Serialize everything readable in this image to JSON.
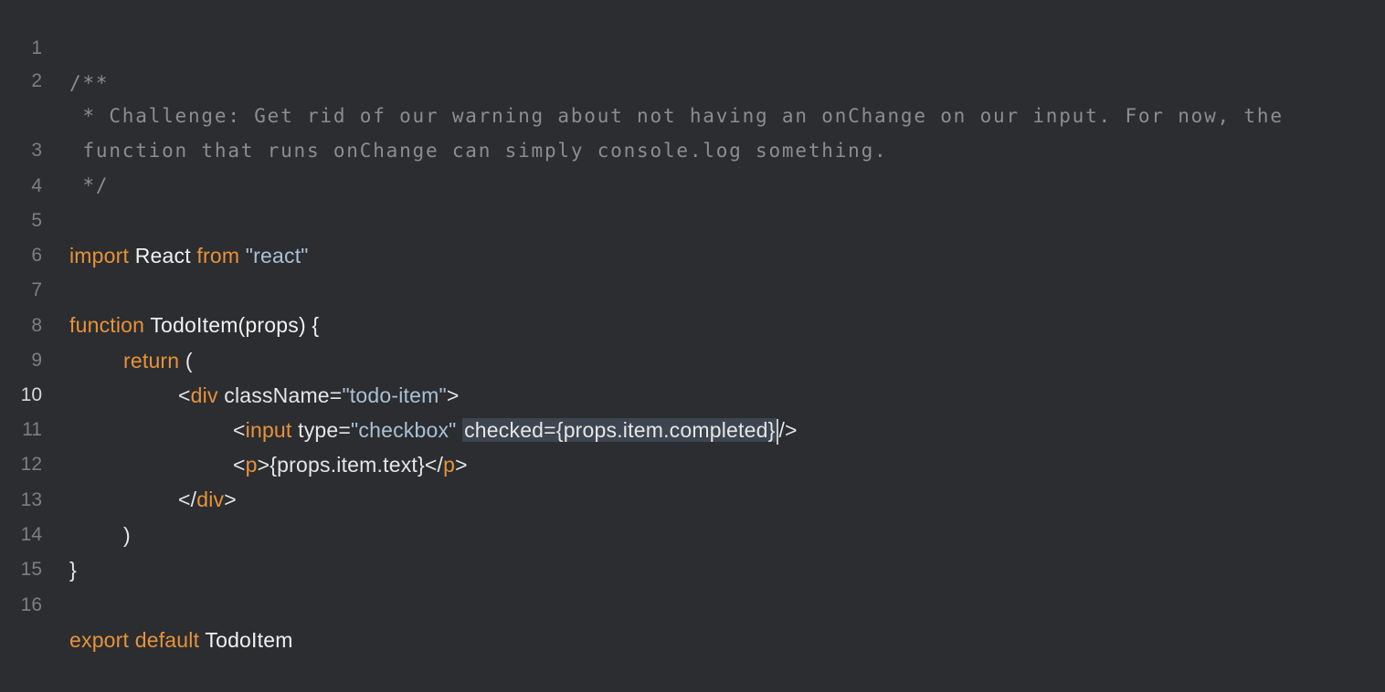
{
  "editor": {
    "lines": [
      {
        "num": "1",
        "text": "/**"
      },
      {
        "num": "2",
        "text": " * Challenge: Get rid of our warning about not having an onChange on our input. For now, the"
      },
      {
        "num": "",
        "text": " function that runs onChange can simply console.log something."
      },
      {
        "num": "3",
        "text": " */"
      },
      {
        "num": "4",
        "text": ""
      },
      {
        "num": "5",
        "kw1": "import",
        "id1": "React",
        "kw2": "from",
        "str1": "\"react\""
      },
      {
        "num": "6",
        "text": ""
      },
      {
        "num": "7",
        "kw1": "function",
        "id1": "TodoItem(props) {"
      },
      {
        "num": "8",
        "kw1": "return",
        "punc": "("
      },
      {
        "num": "9",
        "open": "<",
        "tag": "div",
        "attr": "className=",
        "str1": "\"todo-item\"",
        "close": ">"
      },
      {
        "num": "10",
        "open": "<",
        "tag": "input",
        "attr": "type=",
        "str1": "\"checkbox\"",
        "sel": "checked={props.item.completed}",
        "close": "/>"
      },
      {
        "num": "11",
        "open": "<",
        "tag": "p",
        "mid": ">{props.item.text}</",
        "tag2": "p",
        "close": ">"
      },
      {
        "num": "12",
        "open": "</",
        "tag": "div",
        "close": ">"
      },
      {
        "num": "13",
        "punc": ")"
      },
      {
        "num": "14",
        "punc": "}"
      },
      {
        "num": "15",
        "text": ""
      },
      {
        "num": "16",
        "kw1": "export",
        "kw2": "default",
        "id1": "TodoItem"
      }
    ]
  }
}
